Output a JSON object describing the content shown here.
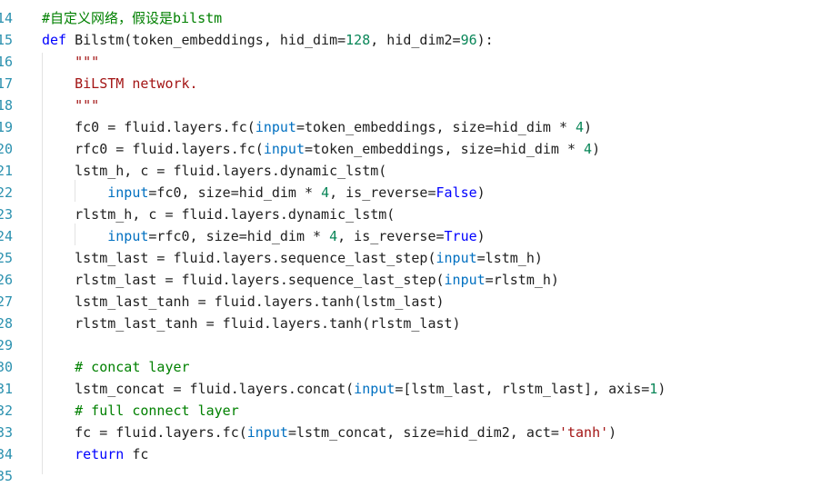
{
  "editor": {
    "line_numbers": [
      "14",
      "15",
      "16",
      "17",
      "18",
      "19",
      "20",
      "21",
      "22",
      "23",
      "24",
      "25",
      "26",
      "27",
      "28",
      "29",
      "30",
      "31",
      "32",
      "33",
      "34",
      "35"
    ],
    "lines": [
      [
        {
          "c": "cm",
          "t": "#自定义网络，假设是bilstm"
        }
      ],
      [
        {
          "c": "kw",
          "t": "def"
        },
        {
          "c": "tx",
          "t": " Bilstm(token_embeddings, hid_dim="
        },
        {
          "c": "nm",
          "t": "128"
        },
        {
          "c": "tx",
          "t": ", hid_dim2="
        },
        {
          "c": "nm",
          "t": "96"
        },
        {
          "c": "tx",
          "t": "):"
        }
      ],
      [
        {
          "c": "tx",
          "t": "    "
        },
        {
          "c": "st",
          "t": "\"\"\""
        }
      ],
      [
        {
          "c": "tx",
          "t": "    "
        },
        {
          "c": "st",
          "t": "BiLSTM network."
        }
      ],
      [
        {
          "c": "tx",
          "t": "    "
        },
        {
          "c": "st",
          "t": "\"\"\""
        }
      ],
      [
        {
          "c": "tx",
          "t": "    fc0 = fluid.layers.fc("
        },
        {
          "c": "pm",
          "t": "input"
        },
        {
          "c": "tx",
          "t": "=token_embeddings, size=hid_dim * "
        },
        {
          "c": "nm",
          "t": "4"
        },
        {
          "c": "tx",
          "t": ")"
        }
      ],
      [
        {
          "c": "tx",
          "t": "    rfc0 = fluid.layers.fc("
        },
        {
          "c": "pm",
          "t": "input"
        },
        {
          "c": "tx",
          "t": "=token_embeddings, size=hid_dim * "
        },
        {
          "c": "nm",
          "t": "4"
        },
        {
          "c": "tx",
          "t": ")"
        }
      ],
      [
        {
          "c": "tx",
          "t": "    lstm_h, c = fluid.layers.dynamic_lstm("
        }
      ],
      [
        {
          "c": "tx",
          "t": "        "
        },
        {
          "c": "pm",
          "t": "input"
        },
        {
          "c": "tx",
          "t": "=fc0, size=hid_dim * "
        },
        {
          "c": "nm",
          "t": "4"
        },
        {
          "c": "tx",
          "t": ", is_reverse="
        },
        {
          "c": "kw",
          "t": "False"
        },
        {
          "c": "tx",
          "t": ")"
        }
      ],
      [
        {
          "c": "tx",
          "t": "    rlstm_h, c = fluid.layers.dynamic_lstm("
        }
      ],
      [
        {
          "c": "tx",
          "t": "        "
        },
        {
          "c": "pm",
          "t": "input"
        },
        {
          "c": "tx",
          "t": "=rfc0, size=hid_dim * "
        },
        {
          "c": "nm",
          "t": "4"
        },
        {
          "c": "tx",
          "t": ", is_reverse="
        },
        {
          "c": "kw",
          "t": "True"
        },
        {
          "c": "tx",
          "t": ")"
        }
      ],
      [
        {
          "c": "tx",
          "t": "    lstm_last = fluid.layers.sequence_last_step("
        },
        {
          "c": "pm",
          "t": "input"
        },
        {
          "c": "tx",
          "t": "=lstm_h)"
        }
      ],
      [
        {
          "c": "tx",
          "t": "    rlstm_last = fluid.layers.sequence_last_step("
        },
        {
          "c": "pm",
          "t": "input"
        },
        {
          "c": "tx",
          "t": "=rlstm_h)"
        }
      ],
      [
        {
          "c": "tx",
          "t": "    lstm_last_tanh = fluid.layers.tanh(lstm_last)"
        }
      ],
      [
        {
          "c": "tx",
          "t": "    rlstm_last_tanh = fluid.layers.tanh(rlstm_last)"
        }
      ],
      [],
      [
        {
          "c": "tx",
          "t": "    "
        },
        {
          "c": "cm",
          "t": "# concat layer"
        }
      ],
      [
        {
          "c": "tx",
          "t": "    lstm_concat = fluid.layers.concat("
        },
        {
          "c": "pm",
          "t": "input"
        },
        {
          "c": "tx",
          "t": "=[lstm_last, rlstm_last], axis="
        },
        {
          "c": "nm",
          "t": "1"
        },
        {
          "c": "tx",
          "t": ")"
        }
      ],
      [
        {
          "c": "tx",
          "t": "    "
        },
        {
          "c": "cm",
          "t": "# full connect layer"
        }
      ],
      [
        {
          "c": "tx",
          "t": "    fc = fluid.layers.fc("
        },
        {
          "c": "pm",
          "t": "input"
        },
        {
          "c": "tx",
          "t": "=lstm_concat, size=hid_dim2, act="
        },
        {
          "c": "st",
          "t": "'tanh'"
        },
        {
          "c": "tx",
          "t": ")"
        }
      ],
      [
        {
          "c": "tx",
          "t": "    "
        },
        {
          "c": "kw",
          "t": "return"
        },
        {
          "c": "tx",
          "t": " fc"
        }
      ],
      []
    ],
    "colors": {
      "keyword": "#0000ff",
      "comment": "#008000",
      "string": "#a31515",
      "number": "#098658",
      "param": "#0070c1",
      "text": "#1f1f1f",
      "line_number": "#2b91af"
    }
  }
}
